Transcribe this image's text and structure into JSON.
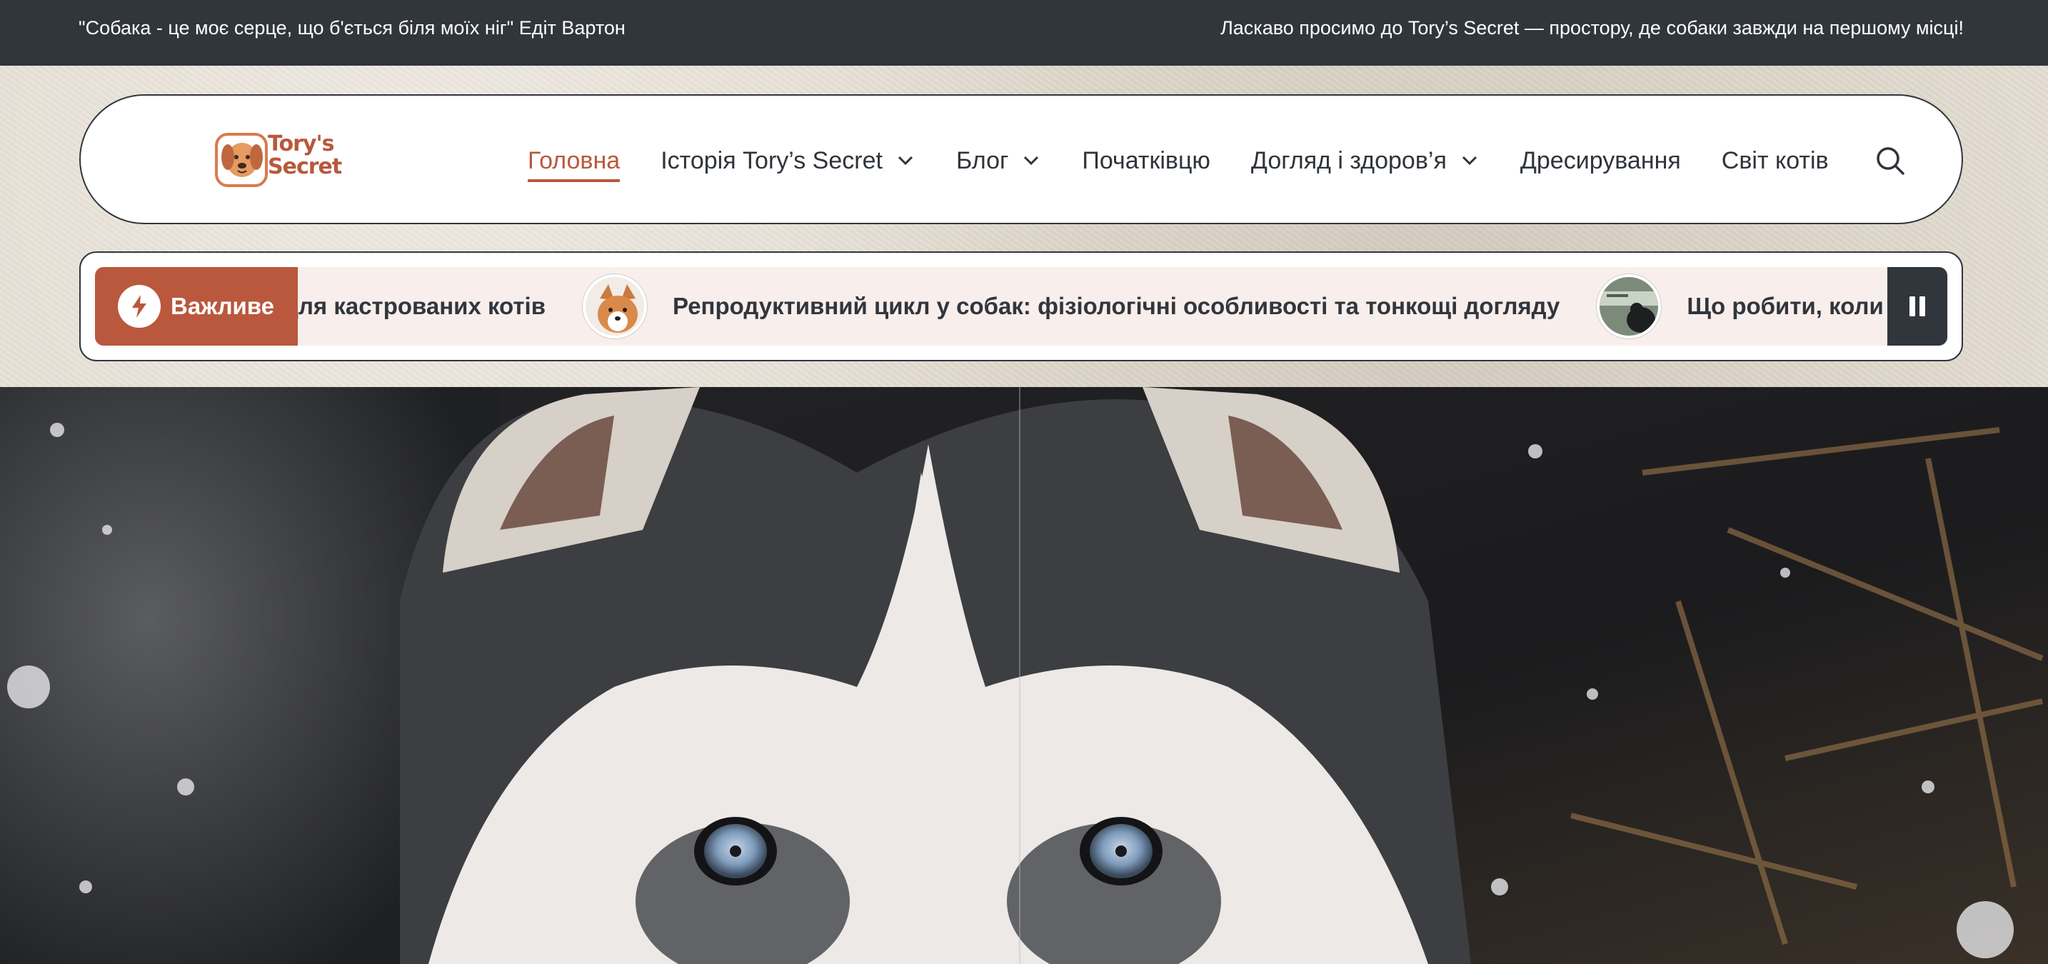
{
  "topbar": {
    "quote": "\"Собака - це моє серце, що б'ється біля моїх ніг\" Едіт Вартон",
    "welcome": "Ласкаво просимо до Tory’s Secret — простору, де собаки завжди на першому місці!"
  },
  "brand": {
    "line1": "Tory's",
    "line2": "Secret",
    "color": "#b9583d"
  },
  "nav": {
    "items": [
      {
        "label": "Головна",
        "active": true,
        "dropdown": false
      },
      {
        "label": "Історія Tory’s Secret",
        "dropdown": true
      },
      {
        "label": "Блог",
        "dropdown": true
      },
      {
        "label": "Початківцю",
        "dropdown": false
      },
      {
        "label": "Догляд і здоров’я",
        "dropdown": true
      },
      {
        "label": "Дресирування",
        "dropdown": false
      },
      {
        "label": "Світ котів",
        "dropdown": false
      }
    ],
    "search_icon": "search-icon"
  },
  "ticker": {
    "badge_label": "Важливе",
    "badge_icon": "lightning-icon",
    "items": [
      {
        "text": "для кастрованих котів"
      },
      {
        "text": "Репродуктивний цикл у собак: фізіологічні особливості та тонкощі догляду",
        "thumb": "corgi-thumbnail"
      },
      {
        "text": "Що робити, коли зак",
        "thumb": "dog-thumbnail"
      }
    ],
    "pause_icon": "pause-icon"
  },
  "hero": {
    "image": "husky-photo"
  },
  "colors": {
    "accent": "#b9583d",
    "dark": "#31363d",
    "ticker_bg": "#f8eeeb",
    "page_bg": "#e4ddd2"
  }
}
